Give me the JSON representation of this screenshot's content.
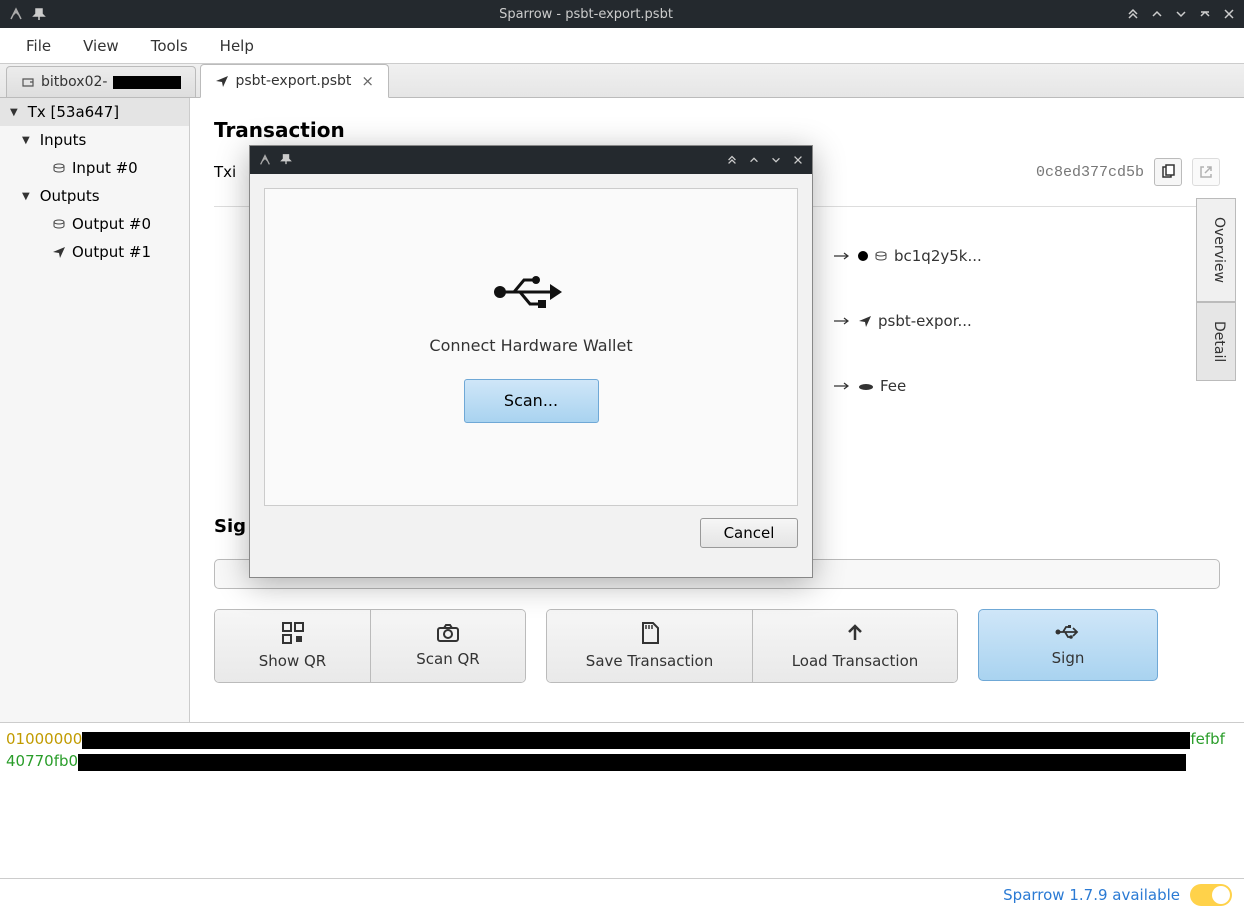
{
  "window_title": "Sparrow - psbt-export.psbt",
  "menubar": [
    "File",
    "View",
    "Tools",
    "Help"
  ],
  "tabs": {
    "inactive": {
      "prefix": "bitbox02-"
    },
    "active": {
      "label": "psbt-export.psbt"
    }
  },
  "tree": {
    "root": "Tx [53a647]",
    "inputs_label": "Inputs",
    "input0": "Input #0",
    "outputs_label": "Outputs",
    "output0": "Output #0",
    "output1": "Output #1"
  },
  "section_title": "Transaction",
  "txid_label": "Txi",
  "txid_suffix": "0c8ed377cd5b",
  "dests": {
    "d1": "bc1q2y5k...",
    "d2": "psbt-expor...",
    "d3": "Fee"
  },
  "side_tabs": {
    "overview": "Overview",
    "detail": "Detail"
  },
  "sig_heading": "Sig",
  "buttons": {
    "show_qr": "Show QR",
    "scan_qr": "Scan QR",
    "save_tx": "Save Transaction",
    "load_tx": "Load Transaction",
    "sign": "Sign"
  },
  "hex": {
    "l1a": "01000000",
    "l1b": "fefbf",
    "l2a": "40770fb0"
  },
  "status": {
    "update": "Sparrow 1.7.9 available"
  },
  "modal": {
    "message": "Connect Hardware Wallet",
    "scan": "Scan...",
    "cancel": "Cancel"
  }
}
